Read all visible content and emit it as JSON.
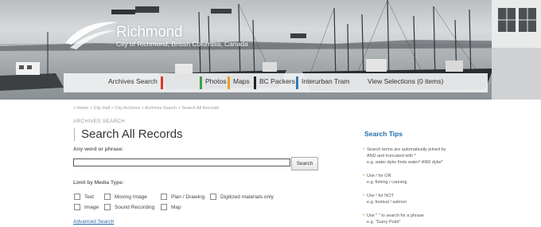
{
  "header": {
    "brand_name": "Richmond",
    "brand_subtitle": "City of Richmond, British Columbia, Canada"
  },
  "nav": {
    "items": [
      {
        "label": "Archives Search",
        "accent": "#d8362a"
      },
      {
        "label": "Photos",
        "accent": "#3aa14a"
      },
      {
        "label": "Maps",
        "accent": "#e8a02c"
      },
      {
        "label": "BC Packers",
        "accent": "#222222"
      },
      {
        "label": "Interurban Tram",
        "accent": "#2e7bbf"
      },
      {
        "label": "View Selections (0 items)",
        "accent": null
      }
    ]
  },
  "breadcrumb": "> Home > City Hall > City Archives > Archives Search > Search All Records",
  "section_tag": "ARCHIVES SEARCH",
  "page_title": "Search All Records",
  "search": {
    "label": "Any word or phrase:",
    "value": "",
    "button_label": "Search"
  },
  "media_type": {
    "label": "Limit by Media Type:",
    "options": [
      {
        "label": "Text",
        "checked": false
      },
      {
        "label": "Moving Image",
        "checked": false
      },
      {
        "label": "Plan / Drawing",
        "checked": false
      },
      {
        "label": "Digitized materials only",
        "checked": false
      },
      {
        "label": "Image",
        "checked": false
      },
      {
        "label": "Sound Recording",
        "checked": false
      },
      {
        "label": "Map",
        "checked": false
      }
    ]
  },
  "advanced_search_label": "Advanced Search",
  "tips": {
    "title": "Search Tips",
    "items": [
      {
        "lines": [
          "Search terms are automatically joined by",
          "AND and truncated with *",
          "e.g. water dyke finds water* AND dyke*"
        ]
      },
      {
        "lines": [
          "Use / for OR",
          "e.g. fishing / canning"
        ]
      },
      {
        "lines": [
          "Use ! for NOT",
          "e.g. festival ! salmon"
        ]
      },
      {
        "lines": [
          "Use \" \" to search for a phrase",
          "e.g. \"Garry Point\""
        ]
      }
    ]
  },
  "colors": {
    "link": "#2a6aa8",
    "tips_title": "#1f6fb2",
    "bullet": "#e2a43a"
  }
}
